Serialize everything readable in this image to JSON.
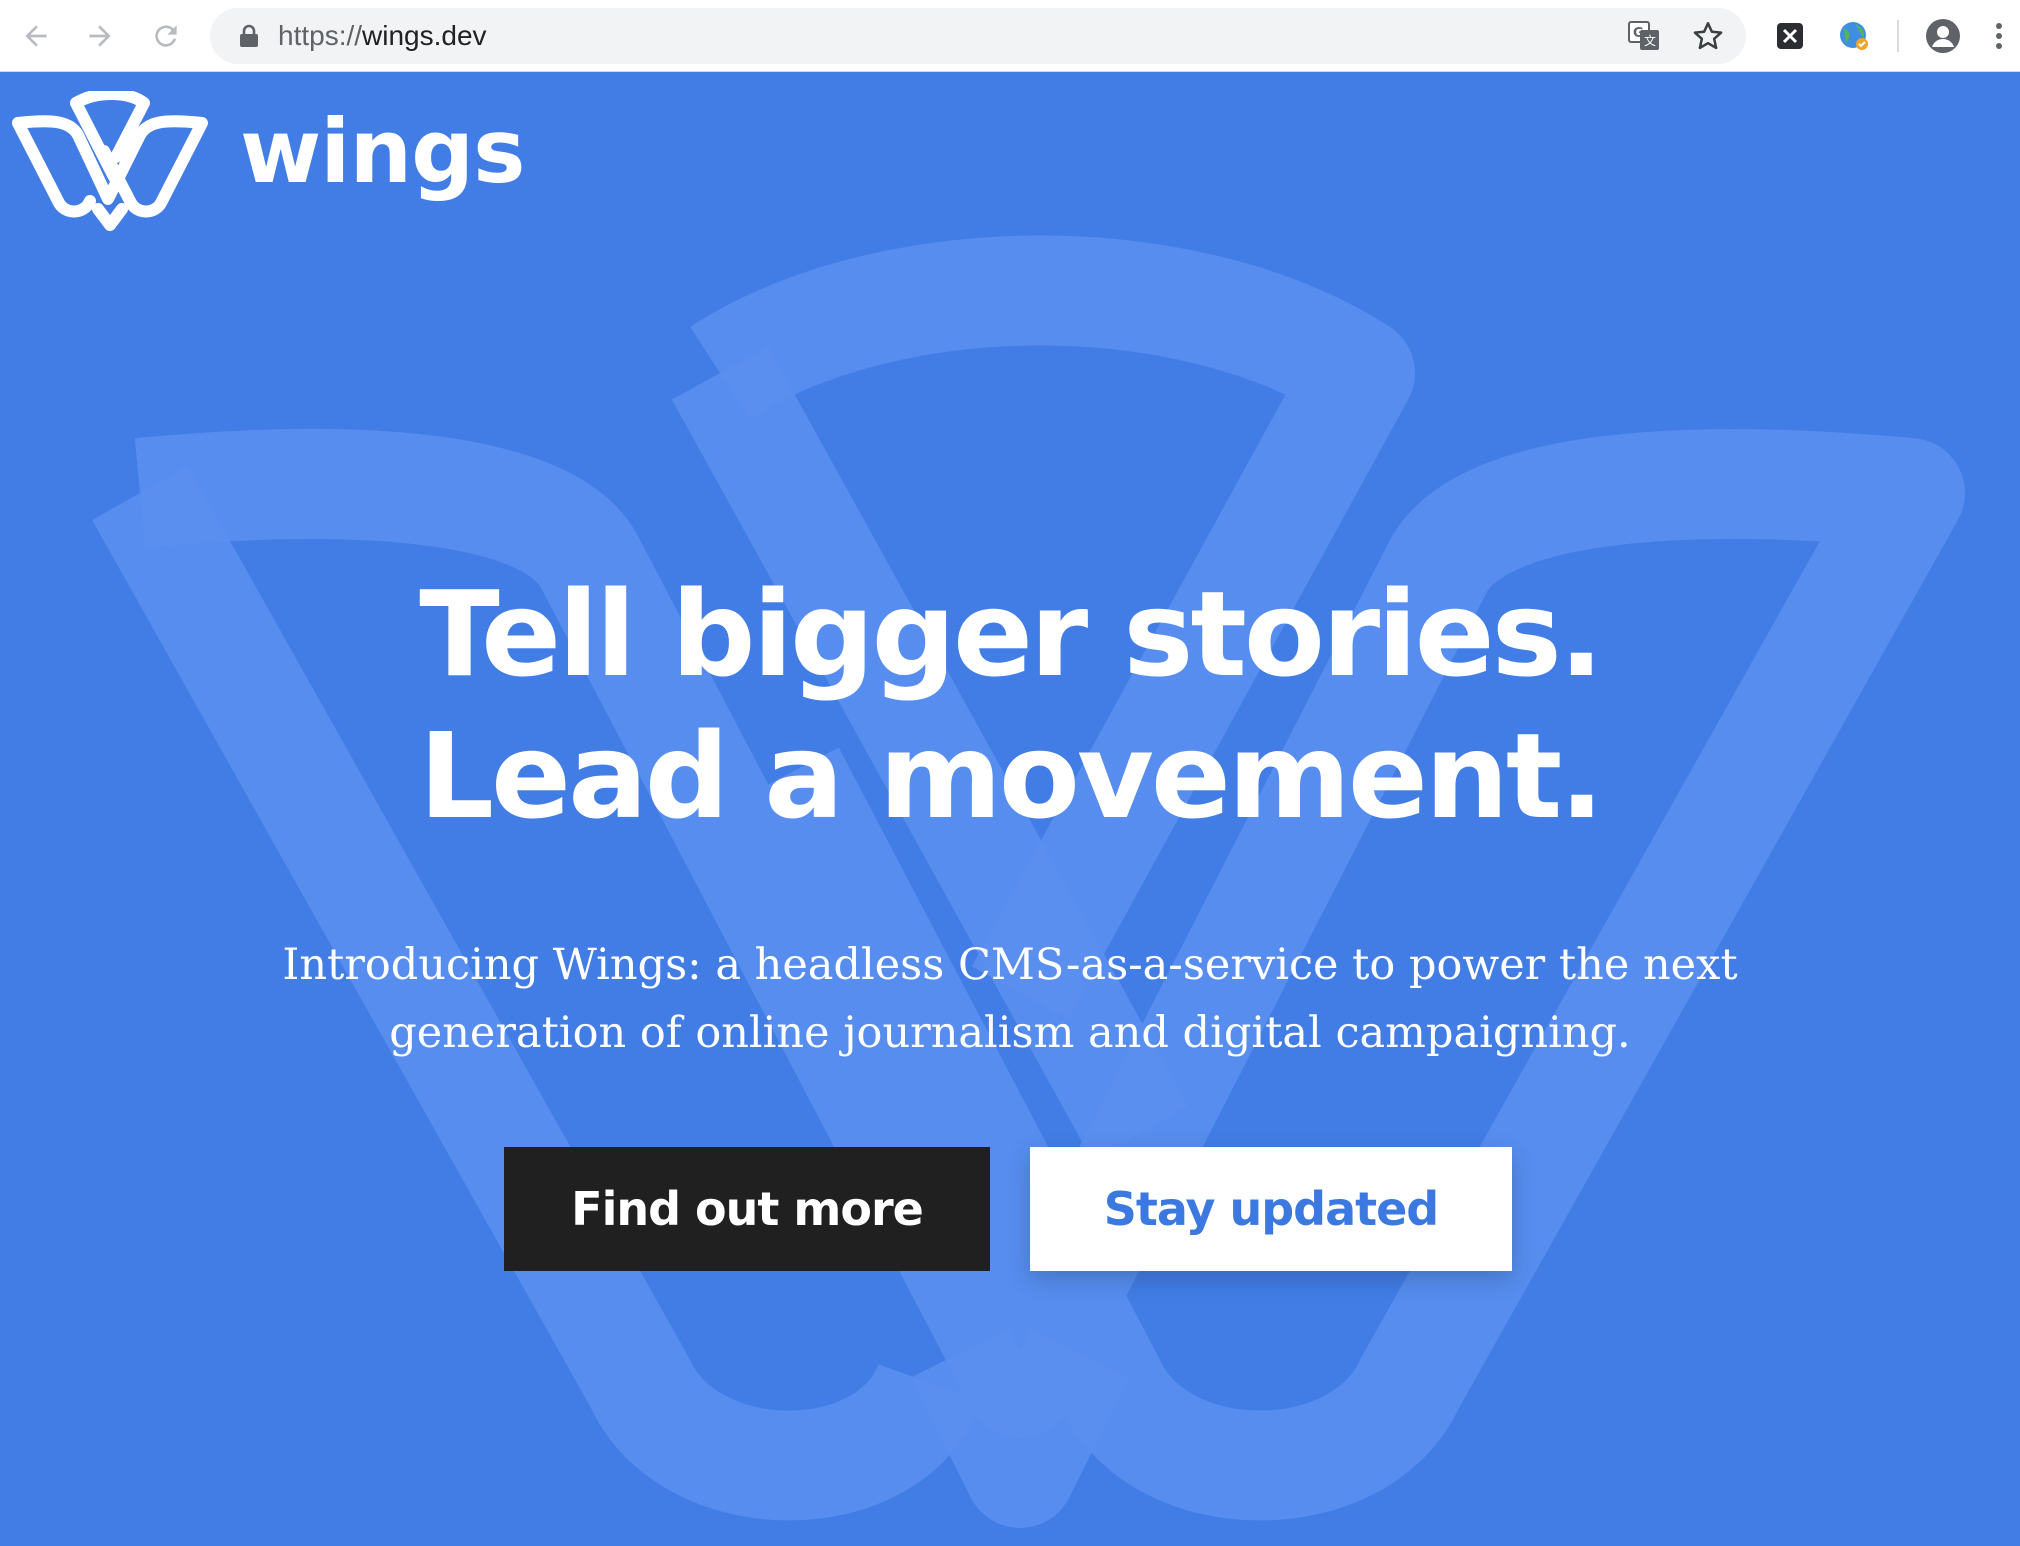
{
  "browser": {
    "url_scheme": "https://",
    "url_host": "wings.dev",
    "icons": [
      "back-icon",
      "forward-icon",
      "reload-icon",
      "lock-icon",
      "translate-icon",
      "bookmark-star-icon",
      "extension-x-icon",
      "extension-globe-icon",
      "profile-icon",
      "menu-icon"
    ]
  },
  "site": {
    "logo_text": "wings",
    "hero": {
      "title_line1": "Tell bigger stories.",
      "title_line2": "Lead a movement.",
      "subtitle_line1": "Introducing Wings: a headless CMS-as-a-service to power the next",
      "subtitle_line2": "generation of online journalism and digital campaigning."
    },
    "buttons": {
      "primary_label": "Find out more",
      "secondary_label": "Stay updated"
    }
  },
  "colors": {
    "background": "#417de5",
    "primary_button": "#202020",
    "secondary_text": "#3b78e0"
  }
}
